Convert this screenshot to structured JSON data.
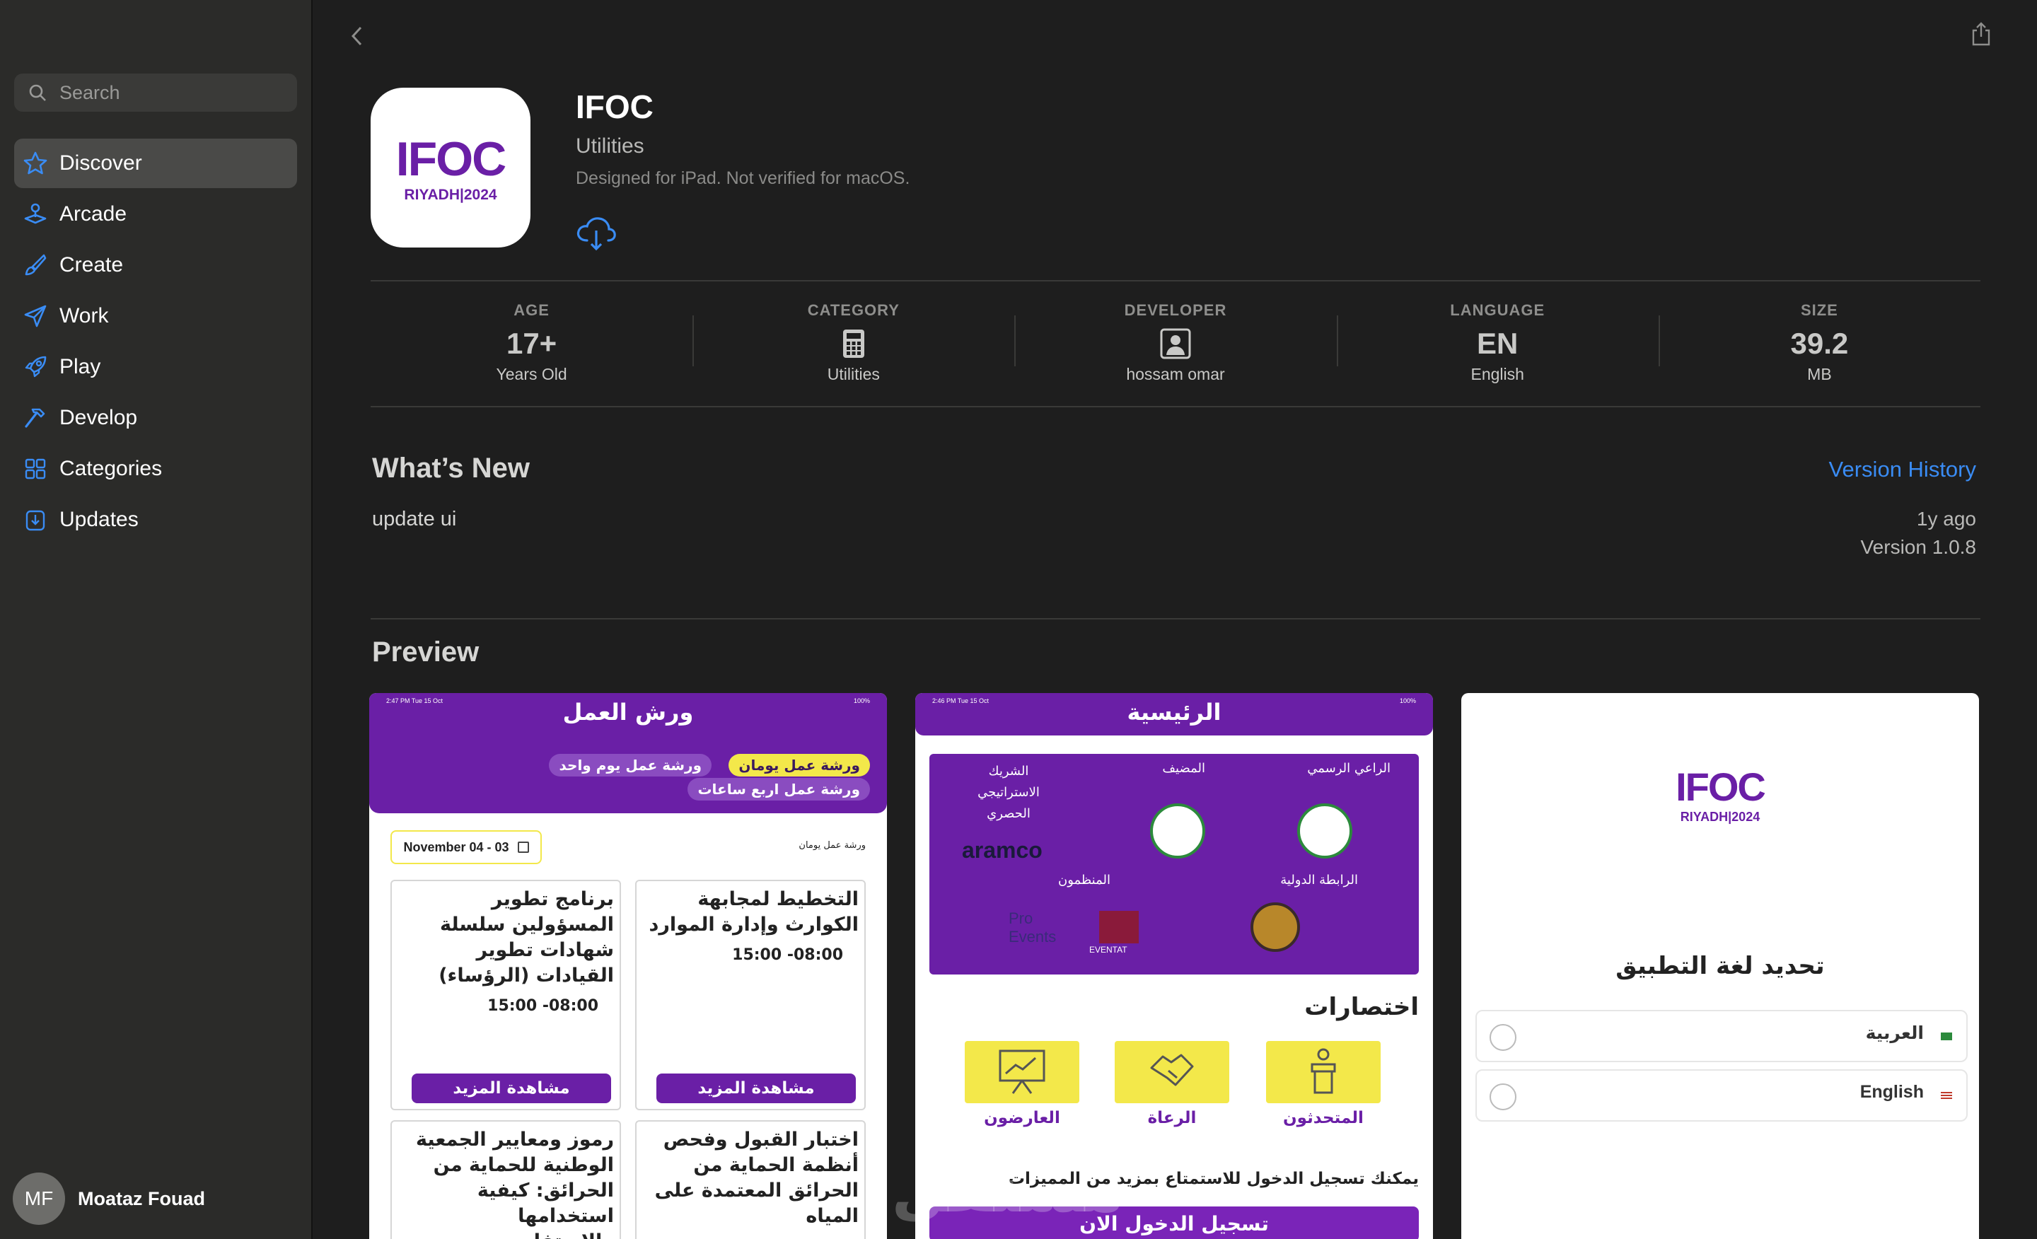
{
  "sidebar": {
    "search_placeholder": "Search",
    "items": [
      {
        "label": "Discover",
        "icon": "star-icon"
      },
      {
        "label": "Arcade",
        "icon": "joystick-icon"
      },
      {
        "label": "Create",
        "icon": "brush-icon"
      },
      {
        "label": "Work",
        "icon": "paper-plane-icon"
      },
      {
        "label": "Play",
        "icon": "rocket-icon"
      },
      {
        "label": "Develop",
        "icon": "hammer-icon"
      },
      {
        "label": "Categories",
        "icon": "grid-icon"
      },
      {
        "label": "Updates",
        "icon": "download-icon"
      }
    ],
    "selected": "Discover",
    "user": {
      "initials": "MF",
      "name": "Moataz Fouad"
    }
  },
  "app": {
    "name": "IFOC",
    "category": "Utilities",
    "note": "Designed for iPad. Not verified for macOS.",
    "icon_text": "IFOC",
    "icon_subtext": "RIYADH|2024"
  },
  "info": {
    "age": {
      "label": "AGE",
      "value": "17+",
      "sub": "Years Old"
    },
    "category": {
      "label": "CATEGORY",
      "sub": "Utilities"
    },
    "developer": {
      "label": "DEVELOPER",
      "sub": "hossam omar"
    },
    "language": {
      "label": "LANGUAGE",
      "value": "EN",
      "sub": "English"
    },
    "size": {
      "label": "SIZE",
      "value": "39.2",
      "sub": "MB"
    }
  },
  "whats_new": {
    "title": "What’s New",
    "version_history": "Version History",
    "notes": "update ui",
    "ago": "1y ago",
    "version": "Version 1.0.8"
  },
  "preview": {
    "title": "Preview",
    "shot1": {
      "status_left": "2:47 PM  Tue 15 Oct",
      "status_right": "100%",
      "title": "ورش العمل",
      "chips": [
        "ورشة عمل يومان",
        "ورشة عمل يوم واحد",
        "ورشة عمل اربع ساعات"
      ],
      "date": "November 04 - 03",
      "filter": "ورشة عمل يومان",
      "cards": [
        {
          "title": "التخطيط لمجابهة الكوارث وإدارة الموارد",
          "time": "08:00- 15:00",
          "button": "مشاهدة المزيد"
        },
        {
          "title": "برنامج تطوير المسؤولين سلسلة شهادات تطوير القيادات (الرؤساء)",
          "time": "08:00- 15:00",
          "button": "مشاهدة المزيد"
        },
        {
          "title": "اختبار القبول وفحص أنظمة الحماية من الحرائق المعتمدة على المياه"
        },
        {
          "title": "رموز ومعايير الجمعية الوطنية للحماية من الحرائق: كيفية استخدامها والاستفاد..."
        }
      ]
    },
    "shot2": {
      "status_left": "2:46 PM  Tue 15 Oct",
      "status_right": "100%",
      "title": "الرئيسية",
      "sponsors": [
        "الراعي الرسمي",
        "المضيف",
        "الشريك الاستراتيجي الحصري",
        "الرابطة الدولية",
        "المنظمون"
      ],
      "logo_text": [
        "aramco",
        "Pro Events",
        "EVENTAT"
      ],
      "shortcuts_title": "اختصارات",
      "shortcuts": [
        "المتحدثون",
        "الرعاة",
        "العارضون"
      ],
      "login_text": "يمكنك تسجيل الدخول للاستمتاع بمزيد من المميزات",
      "login_button": "تسجيل الدخول الان"
    },
    "shot3": {
      "logo_text": "IFOC",
      "logo_sub": "RIYADH|2024",
      "title": "تحديد لغة التطبيق",
      "options": [
        "العربية",
        "English"
      ]
    }
  },
  "watermark": "مستقل",
  "colors": {
    "accent": "#3a8cf4",
    "purple": "#6a1fa6",
    "yellow": "#f3e84a"
  }
}
